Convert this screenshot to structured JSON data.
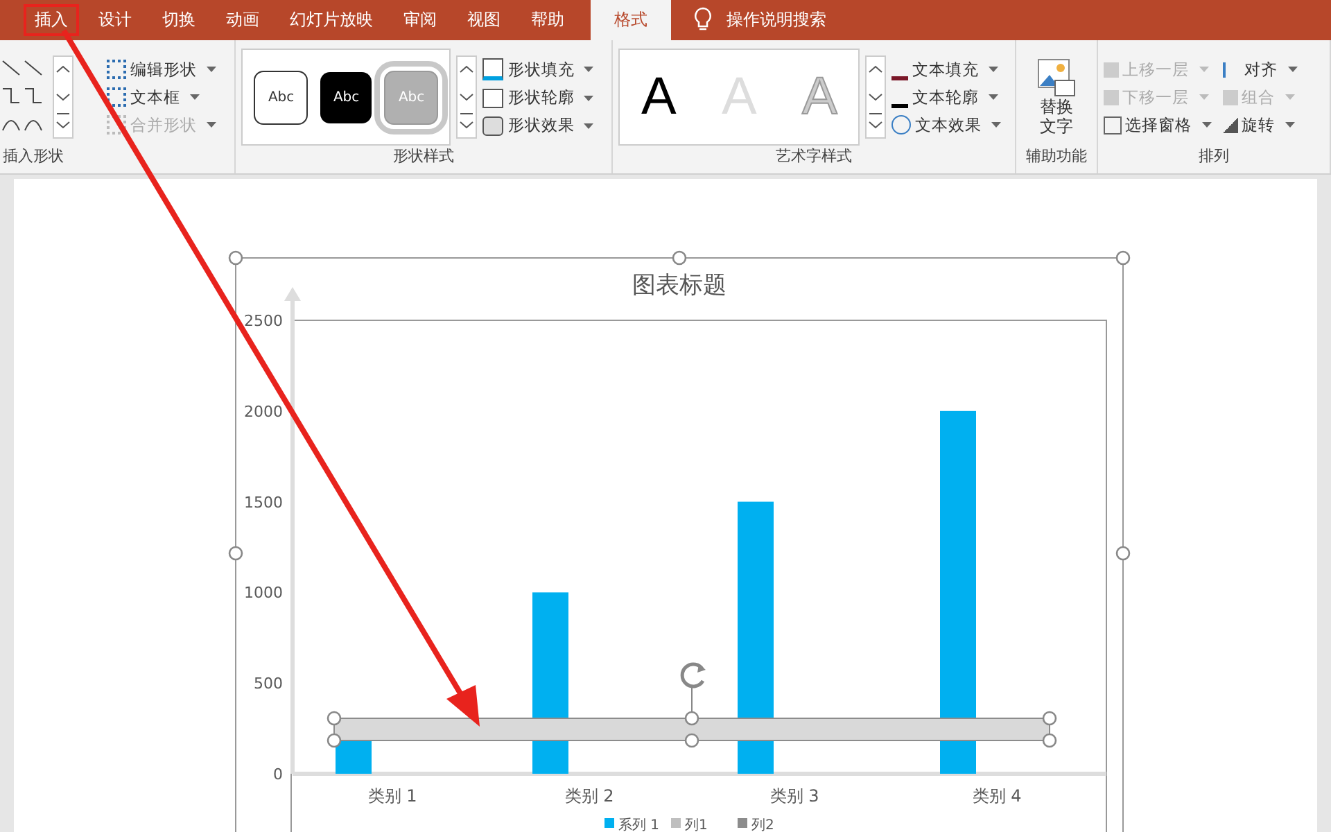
{
  "tabs": [
    {
      "label": "插入",
      "selected": false,
      "annotated": true
    },
    {
      "label": "设计",
      "selected": false,
      "annotated": false
    },
    {
      "label": "切换",
      "selected": false,
      "annotated": false
    },
    {
      "label": "动画",
      "selected": false,
      "annotated": false
    },
    {
      "label": "幻灯片放映",
      "selected": false,
      "annotated": false
    },
    {
      "label": "审阅",
      "selected": false,
      "annotated": false
    },
    {
      "label": "视图",
      "selected": false,
      "annotated": false
    },
    {
      "label": "帮助",
      "selected": false,
      "annotated": false
    },
    {
      "label": "格式",
      "selected": true,
      "annotated": false
    }
  ],
  "search": {
    "placeholder": "操作说明搜索"
  },
  "ribbon": {
    "insert_shapes": {
      "name": "插入形状",
      "items": [
        {
          "label": "编辑形状",
          "disabled": false
        },
        {
          "label": "文本框",
          "disabled": false
        },
        {
          "label": "合并形状",
          "disabled": true
        }
      ]
    },
    "shape_styles": {
      "name": "形状样式",
      "styles": [
        {
          "label": "Abc",
          "kind": "outline",
          "selected": false
        },
        {
          "label": "Abc",
          "kind": "dark",
          "selected": false
        },
        {
          "label": "Abc",
          "kind": "light",
          "selected": true
        }
      ],
      "items": [
        {
          "label": "形状填充",
          "kind": "fill"
        },
        {
          "label": "形状轮廓",
          "kind": "outline"
        },
        {
          "label": "形状效果",
          "kind": "effect"
        }
      ]
    },
    "wordart_styles": {
      "name": "艺术字样式",
      "styles": [
        {
          "label": "A",
          "kind": "solid"
        },
        {
          "label": "A",
          "kind": "light"
        },
        {
          "label": "A",
          "kind": "outline"
        }
      ],
      "items": [
        {
          "label": "文本填充",
          "kind": "fill"
        },
        {
          "label": "文本轮廓",
          "kind": "outline"
        },
        {
          "label": "文本效果",
          "kind": "effect"
        }
      ]
    },
    "accessibility": {
      "name": "辅助功能",
      "button": "替换文字"
    },
    "arrange": {
      "name": "排列",
      "items": [
        {
          "label": "上移一层",
          "disabled": true,
          "kind": "forward"
        },
        {
          "label": "对齐",
          "disabled": false,
          "kind": "align"
        },
        {
          "label": "下移一层",
          "disabled": true,
          "kind": "backward"
        },
        {
          "label": "组合",
          "disabled": true,
          "kind": "group"
        },
        {
          "label": "选择窗格",
          "disabled": false,
          "kind": "pane"
        },
        {
          "label": "旋转",
          "disabled": false,
          "kind": "rotate"
        }
      ]
    }
  },
  "chart_data": {
    "type": "bar",
    "title": "图表标题",
    "categories": [
      "类别 1",
      "类别 2",
      "类别 3",
      "类别 4"
    ],
    "series": [
      {
        "name": "系列 1",
        "color": "#00b0f0",
        "values": [
          190,
          1000,
          1500,
          2000
        ]
      },
      {
        "name": "列1",
        "color": "#bfbfbf",
        "values": [
          null,
          null,
          null,
          null
        ]
      },
      {
        "name": "列2",
        "color": "#8c8c8c",
        "values": [
          null,
          null,
          null,
          null
        ]
      }
    ],
    "ylim": [
      0,
      2500
    ],
    "yticks": [
      0,
      500,
      1000,
      1500,
      2000,
      2500
    ]
  }
}
